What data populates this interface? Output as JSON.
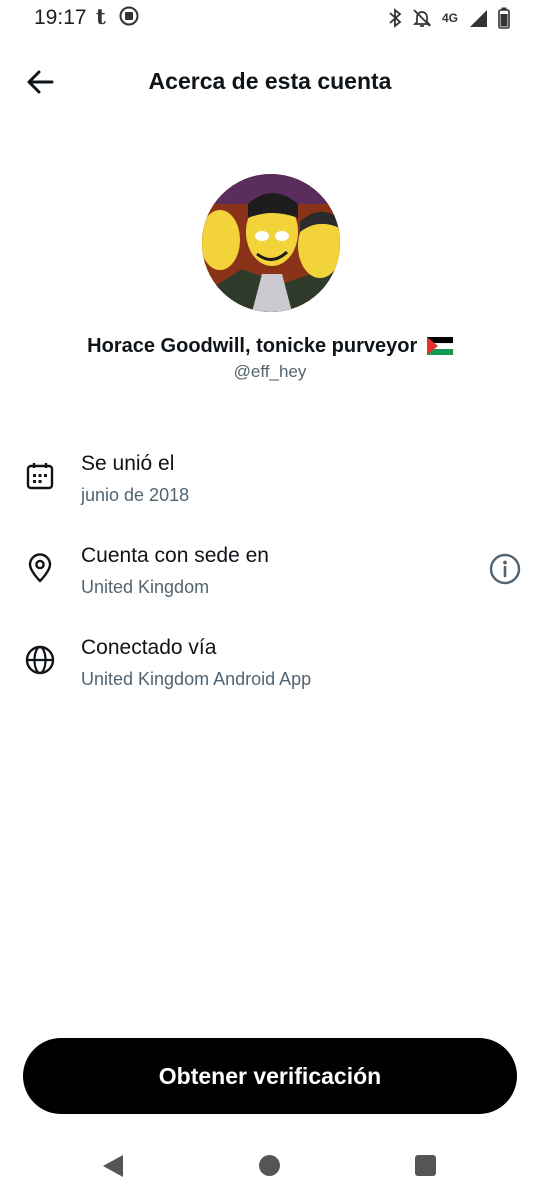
{
  "status_bar": {
    "time": "19:17",
    "tumblr_glyph": "t",
    "network": "4G",
    "icons": [
      "tumblr-icon",
      "app-icon",
      "bluetooth-icon",
      "mute-icon",
      "signal-icon",
      "battery-icon"
    ]
  },
  "header": {
    "title": "Acerca de esta cuenta",
    "back_icon": "arrow-left-icon"
  },
  "profile": {
    "display_name": "Horace Goodwill, tonicke purveyor",
    "flag_icon": "palestine-flag-icon",
    "handle": "@eff_hey"
  },
  "details": [
    {
      "icon": "calendar-icon",
      "label": "Se unió el",
      "value": "junio de 2018"
    },
    {
      "icon": "location-pin-icon",
      "label": "Cuenta con sede en",
      "value": "United Kingdom",
      "action_icon": "info-icon"
    },
    {
      "icon": "globe-icon",
      "label": "Conectado vía",
      "value": "United Kingdom Android App"
    }
  ],
  "cta": {
    "label": "Obtener verificación"
  },
  "colors": {
    "primary_text": "#0f1419",
    "secondary_text": "#536471",
    "button_bg": "#000000",
    "button_text": "#ffffff"
  }
}
